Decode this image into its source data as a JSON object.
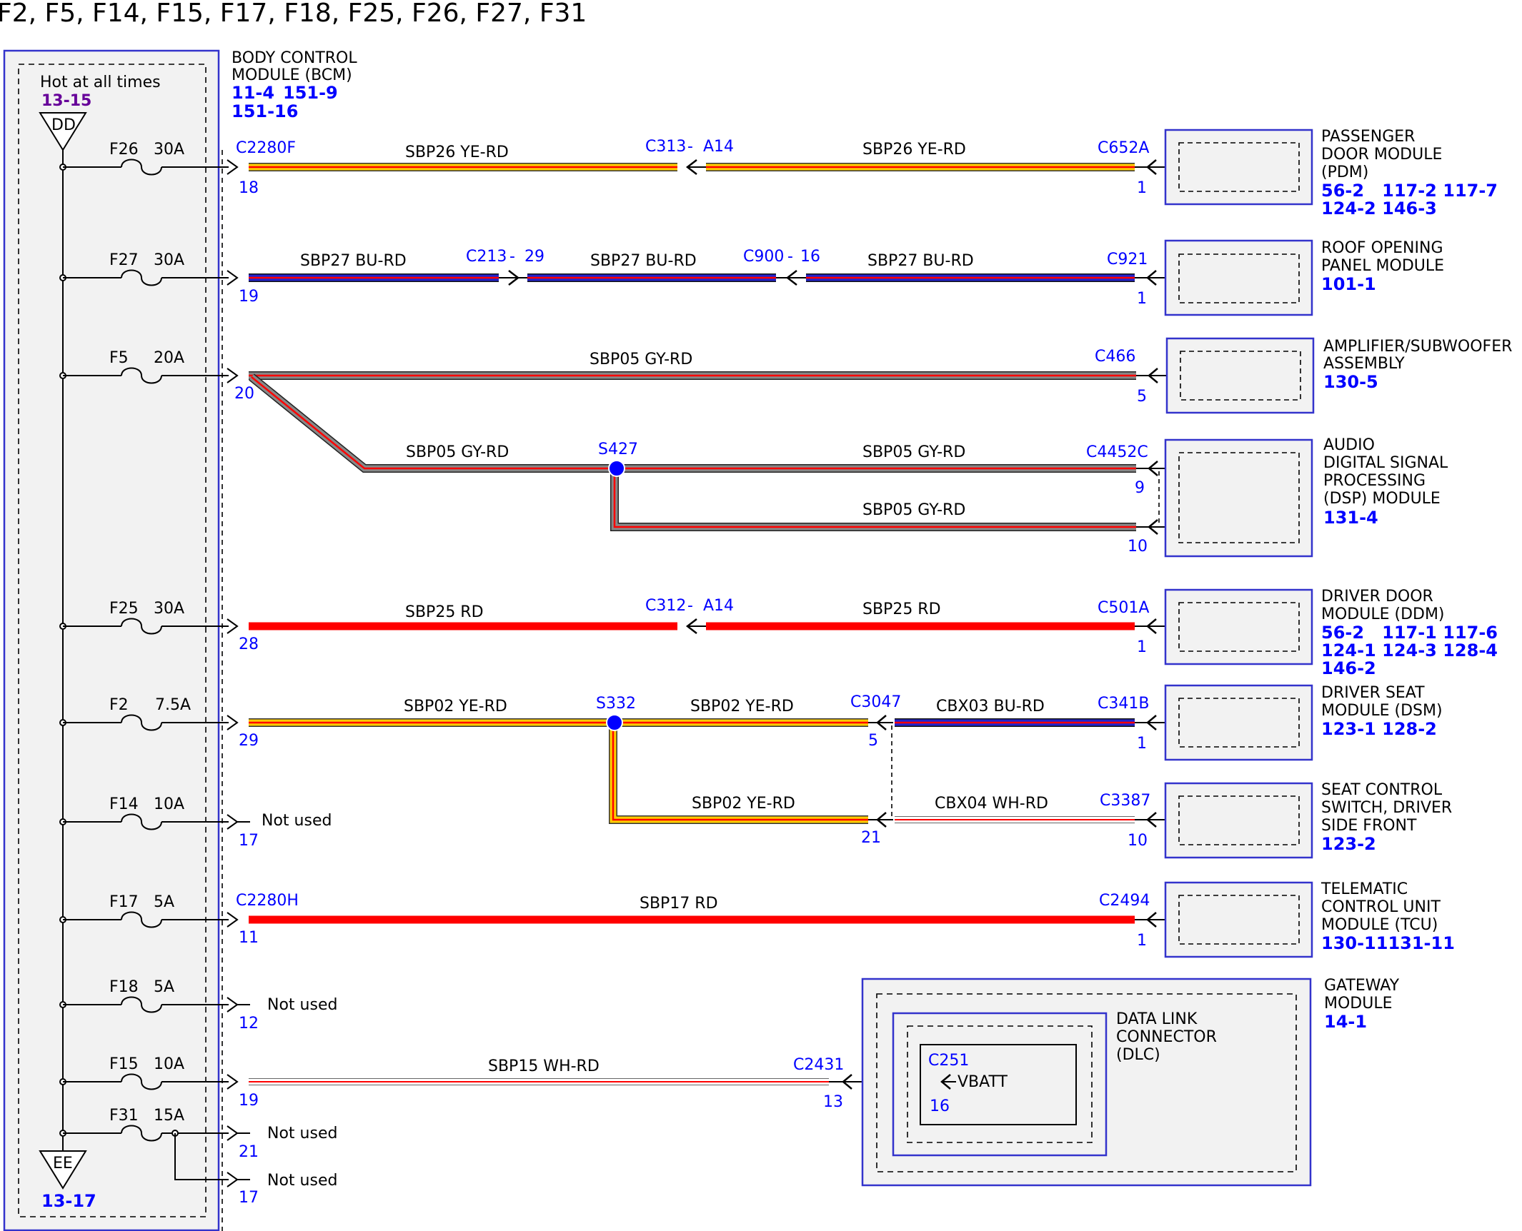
{
  "title": "F2, F5, F14, F15, F17, F18, F25, F26, F27, F31",
  "colors": {
    "ye_rd": [
      "#ffcc00",
      "#ff0000"
    ],
    "bu_rd": [
      "#2222cc",
      "#ff0000"
    ],
    "gy_rd": [
      "#888888",
      "#ff0000"
    ],
    "rd": [
      "#ff0000"
    ],
    "wh_rd": [
      "#ffffff",
      "#ff0000"
    ],
    "connector_text": "#0000ff",
    "page_ref": "#0000ff"
  },
  "bcm": {
    "name_lines": [
      "BODY CONTROL",
      "MODULE (BCM)"
    ],
    "refs": [
      "11-4",
      "151-9",
      "151-16"
    ],
    "hot_label": "Hot at all times",
    "hot_ref": "13-15",
    "bus_top": "DD",
    "bus_bottom": "EE",
    "bus_bottom_ref": "13-17"
  },
  "fuses": [
    {
      "fuse": "F26",
      "amps": "30A",
      "pin": "18",
      "connector": "C2280F"
    },
    {
      "fuse": "F27",
      "amps": "30A",
      "pin": "19"
    },
    {
      "fuse": "F5",
      "amps": "20A",
      "pin": "20"
    },
    {
      "fuse": "F25",
      "amps": "30A",
      "pin": "28"
    },
    {
      "fuse": "F2",
      "amps": "7.5A",
      "pin": "29"
    },
    {
      "fuse": "F14",
      "amps": "10A",
      "pin": "17",
      "note": "Not used"
    },
    {
      "fuse": "F17",
      "amps": "5A",
      "pin": "11",
      "connector": "C2280H"
    },
    {
      "fuse": "F18",
      "amps": "5A",
      "pin": "12",
      "note": "Not used"
    },
    {
      "fuse": "F15",
      "amps": "10A",
      "pin": "19"
    },
    {
      "fuse": "F31",
      "amps": "15A",
      "pins": [
        "21",
        "17"
      ],
      "notes": [
        "Not used",
        "Not used"
      ]
    }
  ],
  "wires": {
    "sbp26_a": "SBP26   YE-RD",
    "sbp26_b": "SBP26   YE-RD",
    "sbp27_a": "SBP27   BU-RD",
    "sbp27_b": "SBP27   BU-RD",
    "sbp27_c": "SBP27   BU-RD",
    "sbp05_a": "SBP05   GY-RD",
    "sbp05_b": "SBP05   GY-RD",
    "sbp05_c": "SBP05   GY-RD",
    "sbp05_d": "SBP05   GY-RD",
    "sbp25_a": "SBP25   RD",
    "sbp25_b": "SBP25   RD",
    "sbp02_a": "SBP02   YE-RD",
    "sbp02_b": "SBP02   YE-RD",
    "sbp02_c": "SBP02   YE-RD",
    "cbx03": "CBX03   BU-RD",
    "cbx04": "CBX04   WH-RD",
    "sbp17": "SBP17   RD",
    "sbp15": "SBP15   WH-RD"
  },
  "connectors": {
    "c313": "C313",
    "c313_pin": "A14",
    "c652a": "C652A",
    "c652a_pin": "1",
    "c213": "C213",
    "c213_pin": "29",
    "c900": "C900",
    "c900_pin": "16",
    "c921": "C921",
    "c921_pin": "1",
    "c466": "C466",
    "c466_pin": "5",
    "s427": "S427",
    "c4452c": "C4452C",
    "c4452c_pin1": "9",
    "c4452c_pin2": "10",
    "c312": "C312",
    "c312_pin": "A14",
    "c501a": "C501A",
    "c501a_pin": "1",
    "s332": "S332",
    "c3047": "C3047",
    "c3047_pin1": "5",
    "c3047_pin2": "21",
    "c341b": "C341B",
    "c341b_pin": "1",
    "c3387": "C3387",
    "c3387_pin": "10",
    "c2494": "C2494",
    "c2494_pin": "1",
    "c2431": "C2431",
    "c2431_pin": "13",
    "c251": "C251",
    "c251_pin": "16",
    "vbatt": "VBATT"
  },
  "modules": {
    "pdm": {
      "lines": [
        "PASSENGER",
        "DOOR MODULE",
        "(PDM)"
      ],
      "refs": [
        "56-2   117-2 117-7",
        "124-2 146-3"
      ]
    },
    "ropm": {
      "lines": [
        "ROOF OPENING",
        "PANEL MODULE"
      ],
      "refs": [
        "101-1"
      ]
    },
    "amp": {
      "lines": [
        "AMPLIFIER/SUBWOOFER",
        "ASSEMBLY"
      ],
      "refs": [
        "130-5"
      ]
    },
    "dsp": {
      "lines": [
        "AUDIO",
        "DIGITAL SIGNAL",
        "PROCESSING",
        "(DSP) MODULE"
      ],
      "refs": [
        "131-4"
      ]
    },
    "ddm": {
      "lines": [
        "DRIVER DOOR",
        "MODULE (DDM)"
      ],
      "refs": [
        "56-2   117-1 117-6",
        "124-1 124-3 128-4",
        "146-2"
      ]
    },
    "dsm": {
      "lines": [
        "DRIVER SEAT",
        "MODULE (DSM)"
      ],
      "refs": [
        "123-1 128-2"
      ]
    },
    "scs": {
      "lines": [
        "SEAT CONTROL",
        "SWITCH, DRIVER",
        "SIDE FRONT"
      ],
      "refs": [
        "123-2"
      ]
    },
    "tcu": {
      "lines": [
        "TELEMATIC",
        "CONTROL UNIT",
        "MODULE (TCU)"
      ],
      "refs": [
        "130-11131-11"
      ]
    },
    "gw": {
      "lines": [
        "GATEWAY",
        "MODULE"
      ],
      "refs": [
        "14-1"
      ]
    },
    "dlc": {
      "lines": [
        "DATA LINK",
        "CONNECTOR",
        "(DLC)"
      ]
    }
  }
}
